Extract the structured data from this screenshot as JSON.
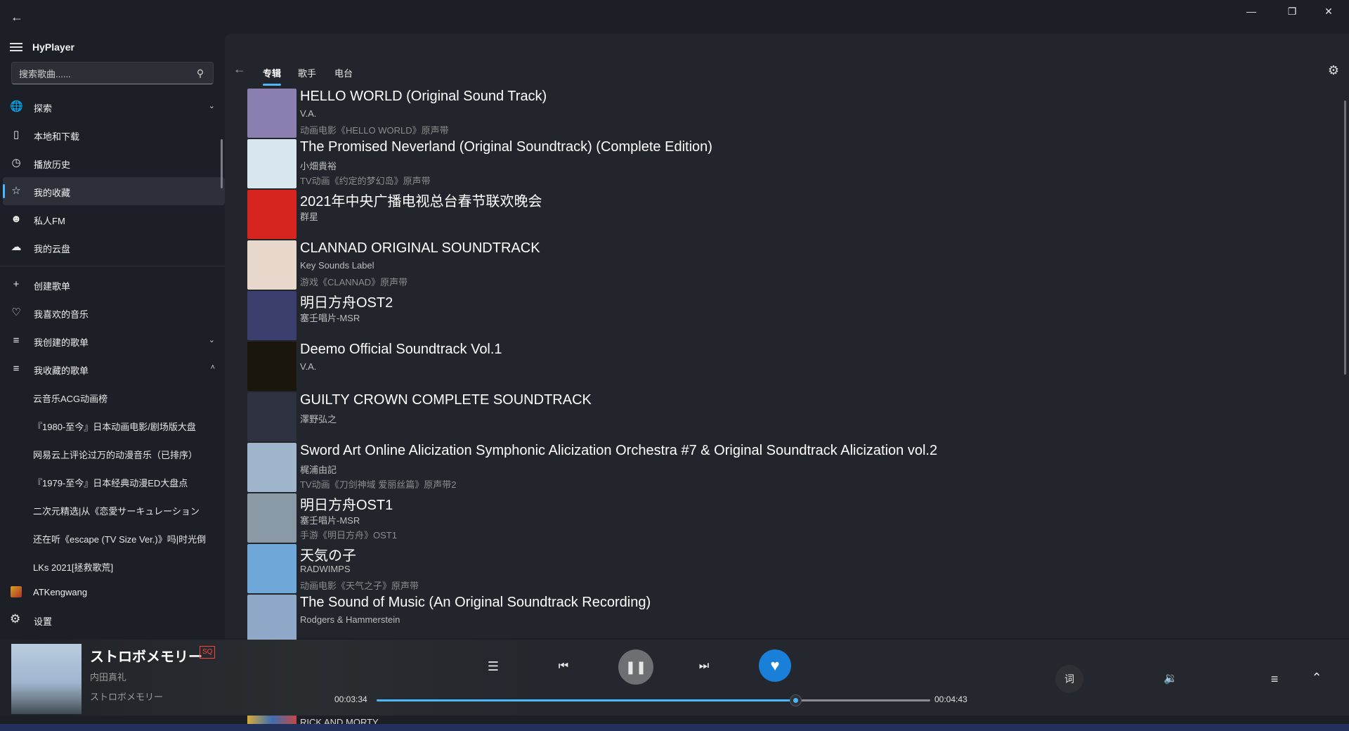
{
  "app": {
    "name": "HyPlayer"
  },
  "search": {
    "placeholder": "搜索歌曲......"
  },
  "nav": {
    "items": [
      {
        "label": "探索",
        "icon": "globe-icon"
      },
      {
        "label": "本地和下载",
        "icon": "device-icon"
      },
      {
        "label": "播放历史",
        "icon": "clock-icon"
      },
      {
        "label": "我的收藏",
        "icon": "star-icon"
      },
      {
        "label": "私人FM",
        "icon": "radio-person-icon"
      },
      {
        "label": "我的云盘",
        "icon": "cloud-icon"
      }
    ],
    "playlist_items": [
      {
        "label": "创建歌单",
        "icon": "plus-icon"
      },
      {
        "label": "我喜欢的音乐",
        "icon": "heart-icon"
      },
      {
        "label": "我创建的歌单",
        "icon": "list-icon"
      },
      {
        "label": "我收藏的歌单",
        "icon": "list-icon"
      }
    ],
    "collected_playlists": [
      "云音乐ACG动画榜",
      "『1980-至今』日本动画电影/剧场版大盘",
      "网易云上评论过万的动漫音乐（已排序）",
      "『1979-至今』日本经典动漫ED大盘点",
      "二次元精选|从《恋愛サーキュレーション",
      "还在听《escape (TV Size Ver.)》吗|时光倒",
      "LKs 2021[拯救歌荒]"
    ],
    "user": "ATKengwang",
    "settings": "设置"
  },
  "tabs": [
    "专辑",
    "歌手",
    "电台"
  ],
  "albums": [
    {
      "title": "HELLO WORLD (Original Sound Track)",
      "artist": "V.A.",
      "desc": "动画电影《HELLO WORLD》原声带",
      "color": "#8a7fb0"
    },
    {
      "title": "The Promised Neverland (Original Soundtrack) (Complete Edition)",
      "artist": "小畑貴裕",
      "desc": "TV动画《约定的梦幻岛》原声带",
      "color": "#d8e6f0"
    },
    {
      "title": "2021年中央广播电视总台春节联欢晚会",
      "artist": "群星",
      "desc": "",
      "color": "#d8241f"
    },
    {
      "title": "CLANNAD ORIGINAL SOUNDTRACK",
      "artist": "Key Sounds Label",
      "desc": "游戏《CLANNAD》原声带",
      "color": "#e8d8cc"
    },
    {
      "title": "明日方舟OST2",
      "artist": "塞壬唱片-MSR",
      "desc": "",
      "color": "#3b3f6e"
    },
    {
      "title": "Deemo Official Soundtrack Vol.1",
      "artist": "V.A.",
      "desc": "",
      "color": "#1a160c"
    },
    {
      "title": "GUILTY CROWN COMPLETE SOUNDTRACK",
      "artist": "澤野弘之",
      "desc": "",
      "color": "#2d3140"
    },
    {
      "title": "Sword Art Online Alicization Symphonic Alicization Orchestra #7 & Original Soundtrack Alicization vol.2",
      "artist": "梶浦由記",
      "desc": "TV动画《刀剑神域 爱丽丝篇》原声带2",
      "color": "#9fb5cc"
    },
    {
      "title": "明日方舟OST1",
      "artist": "塞壬唱片-MSR",
      "desc": "手游《明日方舟》OST1",
      "color": "#8a99a6"
    },
    {
      "title": "天気の子",
      "artist": "RADWIMPS",
      "desc": "动画电影《天气之子》原声带",
      "color": "#6fa7d8"
    },
    {
      "title": "The Sound of Music (An Original Soundtrack Recording)",
      "artist": "Rodgers & Hammerstein",
      "desc": "",
      "color": "#8fa8c8"
    }
  ],
  "peek": {
    "title": "RICK AND MORTY"
  },
  "now_playing": {
    "title": "ストロボメモリー",
    "badge": "SQ",
    "artist": "内田真礼",
    "album": "ストロボメモリー",
    "current_time": "00:03:34",
    "total_time": "00:04:43",
    "progress": 0.7562,
    "liked": true,
    "lyric_label": "词"
  },
  "colors": {
    "accent": "#4db6f7",
    "like": "#1a7fd8",
    "badge": "#ff4040"
  }
}
